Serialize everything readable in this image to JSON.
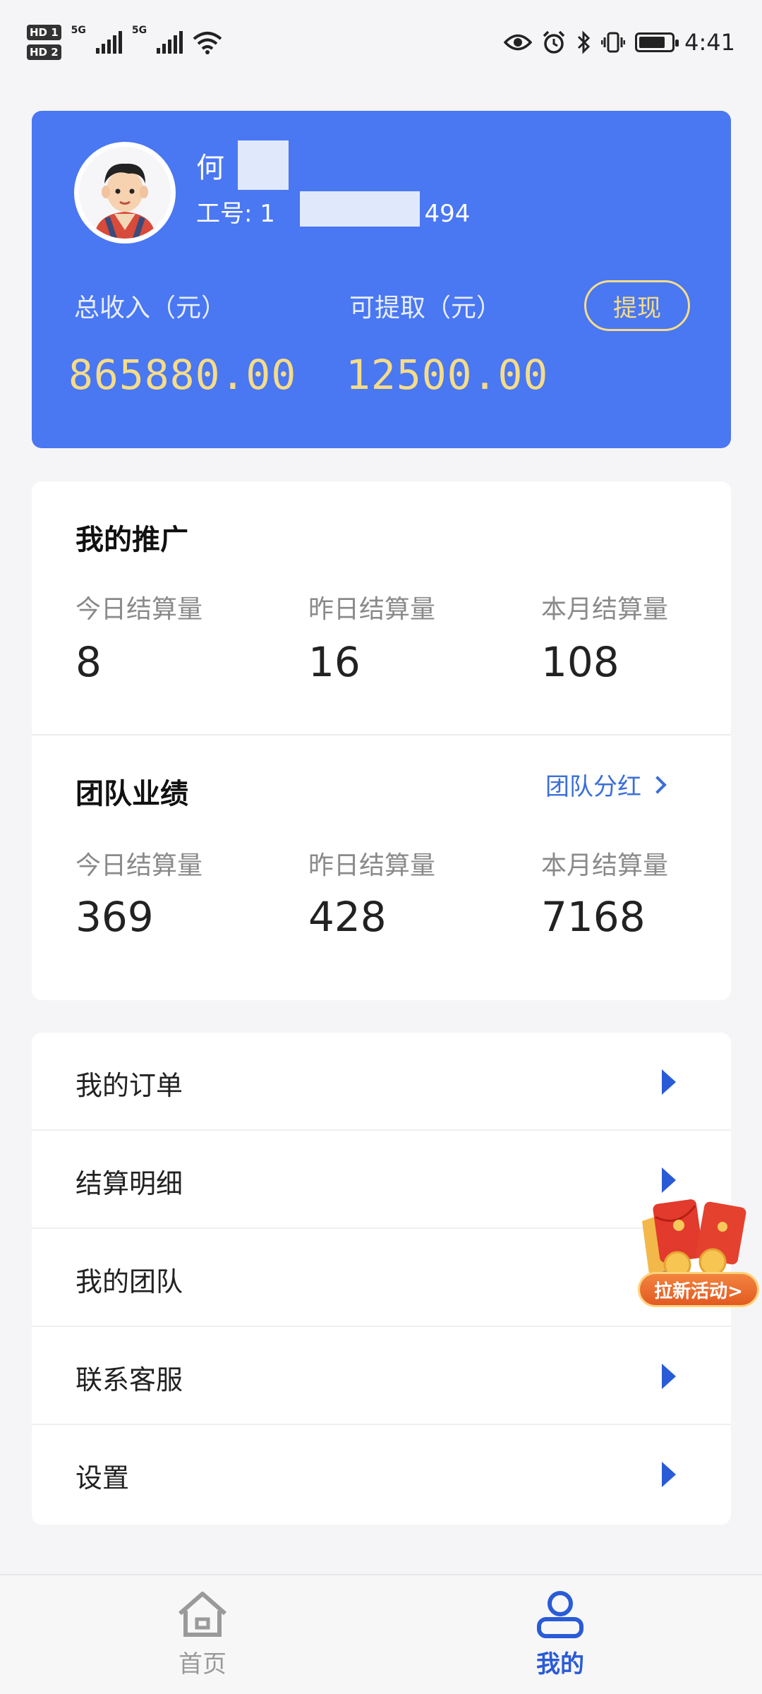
{
  "status_bar": {
    "time": "4:41",
    "network": "5G"
  },
  "profile": {
    "name": "何",
    "employee_id_label": "工号:",
    "employee_id_prefix": "1",
    "employee_id_suffix": "494",
    "total_income_label": "总收入（元）",
    "total_income_value": "865880.00",
    "withdrawable_label": "可提取（元）",
    "withdrawable_value": "12500.00",
    "withdraw_button": "提现"
  },
  "my_promotion": {
    "title": "我的推广",
    "stats": [
      {
        "label": "今日结算量",
        "value": "8"
      },
      {
        "label": "昨日结算量",
        "value": "16"
      },
      {
        "label": "本月结算量",
        "value": "108"
      }
    ]
  },
  "team_performance": {
    "title": "团队业绩",
    "link": "团队分红",
    "stats": [
      {
        "label": "今日结算量",
        "value": "369"
      },
      {
        "label": "昨日结算量",
        "value": "428"
      },
      {
        "label": "本月结算量",
        "value": "7168"
      }
    ]
  },
  "menu": [
    {
      "label": "我的订单"
    },
    {
      "label": "结算明细"
    },
    {
      "label": "我的团队"
    },
    {
      "label": "联系客服"
    },
    {
      "label": "设置"
    }
  ],
  "promo": {
    "label": "拉新活动>"
  },
  "tabs": [
    {
      "label": "首页",
      "active": false
    },
    {
      "label": "我的",
      "active": true
    }
  ],
  "colors": {
    "accent": "#4a77f2",
    "gold": "#f5dc88",
    "link": "#3b6fd8",
    "tab_active": "#2a5bd7",
    "tab_inactive": "#9a9a9a"
  }
}
